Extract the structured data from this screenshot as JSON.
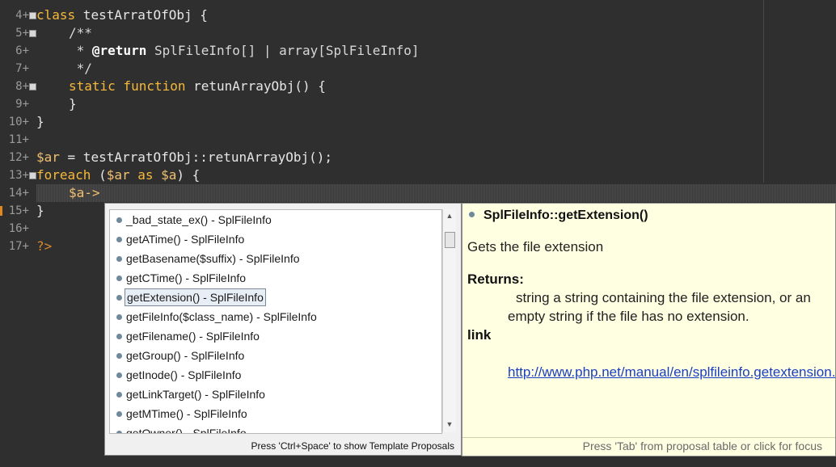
{
  "editor": {
    "line_numbers": [
      "4+",
      "5+",
      "6+",
      "7+",
      "8+",
      "9+",
      "10+",
      "11+",
      "12+",
      "13+",
      "14+",
      "15+",
      "16+",
      "17+"
    ],
    "code": {
      "l4_kw": "class",
      "l4_name": " testArratOfObj {",
      "l5": "/**",
      "l6_star": " * ",
      "l6_tag": "@return",
      "l6_rest": " SplFileInfo[] | array[SplFileInfo]",
      "l7": " */",
      "l8_kw": "static function",
      "l8_rest": " retunArrayObj() {",
      "l9": "}",
      "l10": "}",
      "l12_var": "$ar",
      "l12_rest": " = testArratOfObj::retunArrayObj();",
      "l13_kw": "foreach",
      "l13_p1": " (",
      "l13_v1": "$ar",
      "l13_as": " as ",
      "l13_v2": "$a",
      "l13_p2": ") {",
      "l14": "$a->",
      "l15": "}",
      "l17": "?>"
    }
  },
  "completion": {
    "items": [
      "_bad_state_ex() - SplFileInfo",
      "getATime() - SplFileInfo",
      "getBasename($suffix) - SplFileInfo",
      "getCTime() - SplFileInfo",
      "getExtension() - SplFileInfo",
      "getFileInfo($class_name) - SplFileInfo",
      "getFilename() - SplFileInfo",
      "getGroup() - SplFileInfo",
      "getInode() - SplFileInfo",
      "getLinkTarget() - SplFileInfo",
      "getMTime() - SplFileInfo",
      "getOwner() - SplFileInfo"
    ],
    "selected_index": 4,
    "footer": "Press 'Ctrl+Space' to show Template Proposals"
  },
  "doc": {
    "title": "SplFileInfo::getExtension()",
    "description": "Gets the file extension",
    "returns_heading": "Returns:",
    "returns_line1": "string a string containing the file extension, or an",
    "returns_line2": "empty string if the file has no extension.",
    "link_heading": "link",
    "link": "http://www.php.net/manual/en/splfileinfo.getextension.php",
    "footer": "Press 'Tab' from proposal table or click for focus"
  },
  "colors": {
    "editor_bg": "#2f2f2f",
    "keyword": "#f6b93b",
    "doc_bg": "#ffffe1",
    "link": "#1a3ec4"
  }
}
